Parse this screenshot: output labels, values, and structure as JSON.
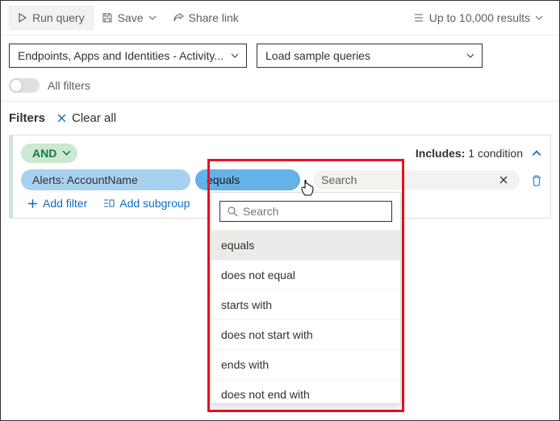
{
  "toolbar": {
    "run": "Run query",
    "save": "Save",
    "share": "Share link",
    "results": "Up to 10,000 results"
  },
  "selectors": {
    "scope": "Endpoints, Apps and Identities - Activity...",
    "sample": "Load sample queries"
  },
  "allFilters": "All filters",
  "filters": {
    "label": "Filters",
    "clear": "Clear all"
  },
  "condGroup": {
    "op": "AND",
    "includesLabel": "Includes:",
    "includesVal": "1 condition"
  },
  "condition": {
    "field": "Alerts: AccountName",
    "operator": "equals",
    "valuePlaceholder": "Search"
  },
  "addFilter": "Add filter",
  "addSubgroup": "Add subgroup",
  "dropdown": {
    "searchPlaceholder": "Search",
    "options": [
      "equals",
      "does not equal",
      "starts with",
      "does not start with",
      "ends with",
      "does not end with"
    ]
  }
}
